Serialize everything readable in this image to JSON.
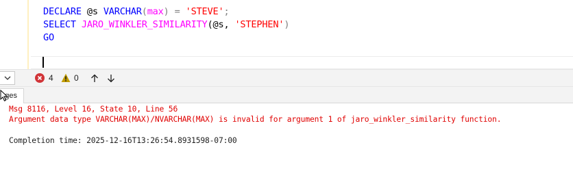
{
  "editor": {
    "line1": {
      "kw1": "DECLARE",
      "var": "@s",
      "kw2": "VARCHAR",
      "paren_open": "(",
      "fn": "max",
      "paren_close": ")",
      "eq": "=",
      "str": "'STEVE'",
      "semi": ";"
    },
    "line2": {
      "kw": "SELECT",
      "fn": "JARO_WINKLER_SIMILARITY",
      "args_open": "(@s, ",
      "str": "'STEPHEN'",
      "args_close": ")"
    },
    "line3": {
      "kw": "GO"
    }
  },
  "statusbar": {
    "error_count": "4",
    "warning_count": "0",
    "icons": [
      "chevron-down-icon",
      "error-icon",
      "warning-icon",
      "arrow-up-icon",
      "arrow-down-icon"
    ],
    "error_color": "#d13438",
    "warning_color": "#c19c00"
  },
  "results": {
    "tab_label": "Messages",
    "tab_label_visible": "ges"
  },
  "messages": {
    "line1": "Msg 8116, Level 16, State 10, Line 56",
    "line2": "Argument data type VARCHAR(MAX)/NVARCHAR(MAX) is invalid for argument 1 of jaro_winkler_similarity function.",
    "completion": "Completion time: 2025-12-16T13:26:54.8931598-07:00",
    "error_text_color": "#e00000"
  }
}
